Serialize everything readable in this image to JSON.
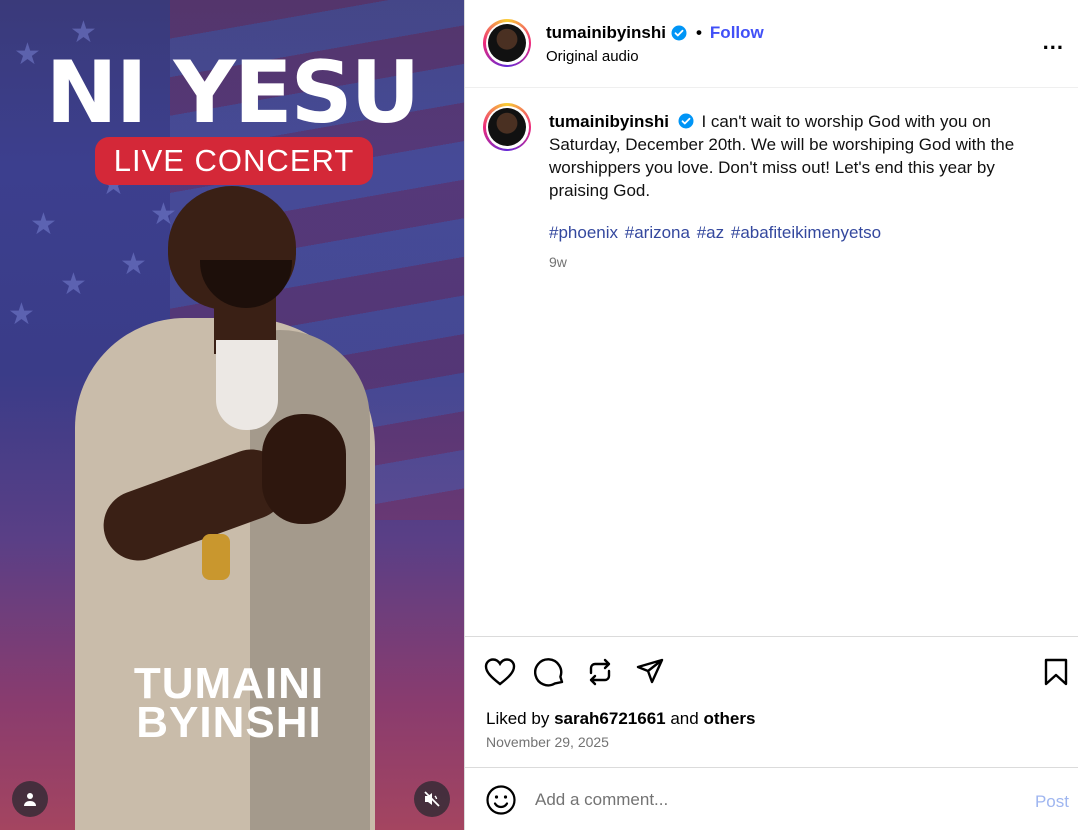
{
  "media": {
    "title": "NI YESU",
    "subtitle": "LIVE CONCERT",
    "artist_line1": "TUMAINI",
    "artist_line2": "BYINSHI",
    "user_icon": "person-icon",
    "mute_icon": "speaker-muted-icon"
  },
  "header": {
    "username": "tumainibyinshi",
    "verified_icon": "verified-badge-icon",
    "separator": "•",
    "follow_label": "Follow",
    "subtitle": "Original audio",
    "more_icon": "more-options-icon",
    "more_label": "..."
  },
  "caption": {
    "username": "tumainibyinshi",
    "text": "I can't wait to worship God with you on Saturday, December 20th. We will be worshiping God with the worshippers you love. Don't miss out! Let's end this year by praising God.",
    "hashtags": [
      "#phoenix",
      "#arizona",
      "#az",
      "#abafiteikimenyetso"
    ],
    "age": "9w"
  },
  "actions": {
    "like_icon": "heart-icon",
    "comment_icon": "comment-bubble-icon",
    "repost_icon": "repost-icon",
    "share_icon": "send-icon",
    "save_icon": "bookmark-icon"
  },
  "likes": {
    "prefix": "Liked by",
    "user": "sarah6721661",
    "middle": "and",
    "others": "others"
  },
  "date": "November 29, 2025",
  "comment": {
    "emoji_icon": "emoji-icon",
    "placeholder": "Add a comment...",
    "post_label": "Post"
  },
  "colors": {
    "follow": "#4150f7",
    "hashtag": "#34489e",
    "verified": "#0095f6",
    "post_disabled": "#9fb6f0",
    "concert_pill": "#d42838"
  }
}
